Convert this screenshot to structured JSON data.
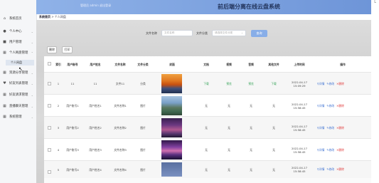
{
  "header": {
    "user_info": "管理员 admin  退出登录",
    "title": "前后端分离在线云盘系统",
    "corner": "L"
  },
  "breadcrumb": {
    "home": "系统首页",
    "sep": ">",
    "current": "个人网盘"
  },
  "sidebar": {
    "items": [
      {
        "label": "系统首页",
        "icon": "home-icon"
      },
      {
        "label": "个人中心",
        "icon": "person-icon"
      },
      {
        "label": "用户管理",
        "icon": "user-icon"
      },
      {
        "label": "个人网盘管理",
        "icon": "grid-icon"
      },
      {
        "label": "资源分享管理",
        "icon": "grid-icon"
      },
      {
        "label": "好友列表管理",
        "icon": "heart-icon"
      },
      {
        "label": "好友请求管理",
        "icon": "grid-icon"
      },
      {
        "label": "直播聊天管理",
        "icon": "grid-icon"
      },
      {
        "label": "系统管理",
        "icon": "grid-icon"
      }
    ],
    "sub_item": "个人网盘"
  },
  "filter": {
    "name_label": "文件名称",
    "name_placeholder": "文件名称",
    "category_label": "文件分类",
    "category_placeholder": "请选择文件分类",
    "search_button": "查询"
  },
  "actions": {
    "delete": "删除",
    "print": "打印"
  },
  "table": {
    "headers": [
      "索引",
      "用户账号",
      "用户姓名",
      "文件名称",
      "文件分类",
      "封面",
      "文档",
      "视频",
      "音频",
      "其他文件",
      "上传时间",
      "操作"
    ],
    "rows": [
      {
        "idx": "1",
        "account": "11",
        "name": "11",
        "file": "文件11",
        "cat": "分类",
        "doc": "下载",
        "video": "预览",
        "audio": "预览",
        "other": "下载",
        "time": "2022-04-17 15:09:29"
      },
      {
        "idx": "2",
        "account": "用户账号1",
        "name": "用户姓名1",
        "file": "文件名称1",
        "cat": "图片",
        "doc": "无",
        "video": "无",
        "audio": "无",
        "other": "无",
        "time": "2022-04-17 15:58:45"
      },
      {
        "idx": "3",
        "account": "用户账号2",
        "name": "用户姓名2",
        "file": "文件名称2",
        "cat": "图片",
        "doc": "无",
        "video": "无",
        "audio": "无",
        "other": "无",
        "time": "2022-04-17 15:58:45"
      },
      {
        "idx": "4",
        "account": "用户账号3",
        "name": "用户姓名3",
        "file": "文件名称3",
        "cat": "图片",
        "doc": "无",
        "video": "无",
        "audio": "无",
        "other": "无",
        "time": "2022-04-17 15:58:45"
      },
      {
        "idx": "5",
        "account": "用户账号4",
        "name": "用户姓名4",
        "file": "文件名称4",
        "cat": "图片",
        "doc": "无",
        "video": "无",
        "audio": "无",
        "other": "无",
        "time": "2022-04-17 15:58:45"
      }
    ],
    "op_detail": "详情",
    "op_edit": "修改",
    "op_delete": "删除"
  },
  "colors": {
    "accent": "#88aee8",
    "header": "#6e95d8",
    "link": "#3a6fd1",
    "danger": "#e03a3a",
    "green": "#3aa55c"
  }
}
